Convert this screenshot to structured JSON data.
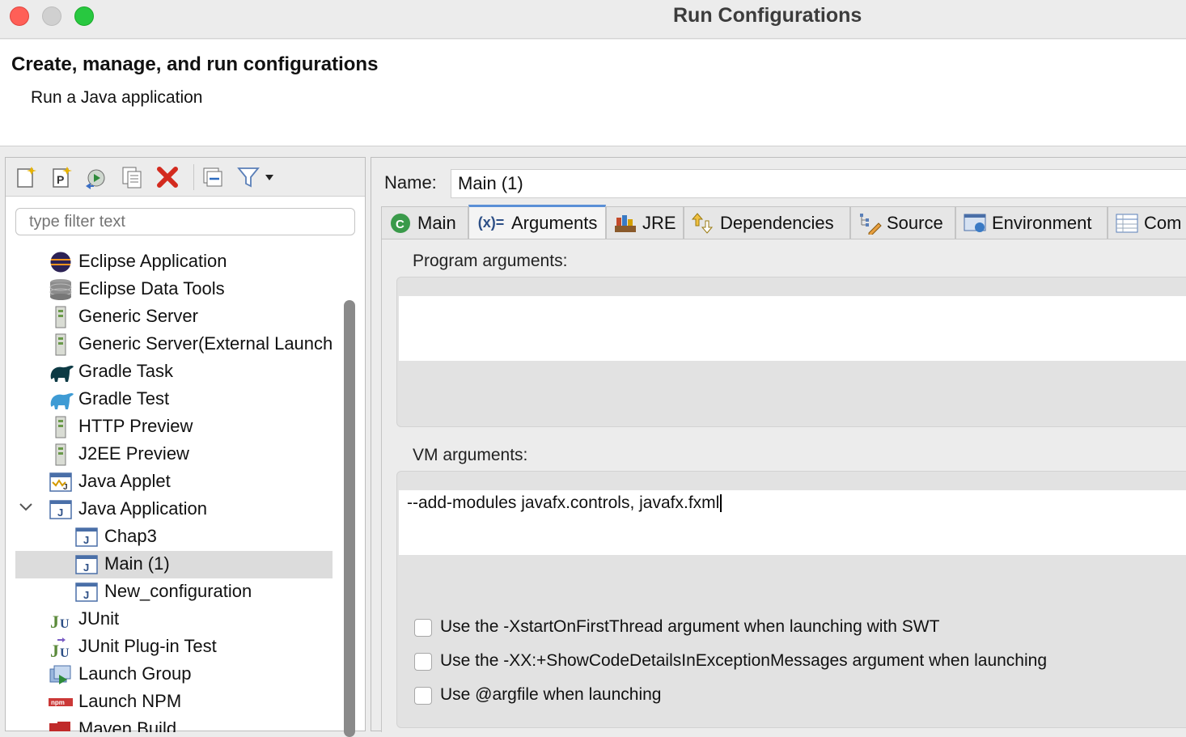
{
  "window": {
    "title": "Run Configurations"
  },
  "header": {
    "title": "Create, manage, and run configurations",
    "subtitle": "Run a Java application"
  },
  "toolbar": {
    "buttons": [
      "new-config-icon",
      "new-prototype-icon",
      "duplicate-icon",
      "copy-icon",
      "delete-icon",
      "collapse-all-icon",
      "filter-icon"
    ]
  },
  "filter": {
    "placeholder": "type filter text"
  },
  "tree": {
    "items": [
      {
        "label": "Eclipse Application",
        "icon": "eclipse-icon",
        "level": 0
      },
      {
        "label": "Eclipse Data Tools",
        "icon": "database-icon",
        "level": 0
      },
      {
        "label": "Generic Server",
        "icon": "server-icon",
        "level": 0
      },
      {
        "label": "Generic Server(External Launch)",
        "icon": "server-icon",
        "level": 0
      },
      {
        "label": "Gradle Task",
        "icon": "gradle-icon",
        "level": 0
      },
      {
        "label": "Gradle Test",
        "icon": "gradle-test-icon",
        "level": 0
      },
      {
        "label": "HTTP Preview",
        "icon": "server-icon",
        "level": 0
      },
      {
        "label": "J2EE Preview",
        "icon": "server-icon",
        "level": 0
      },
      {
        "label": "Java Applet",
        "icon": "java-applet-icon",
        "level": 0
      },
      {
        "label": "Java Application",
        "icon": "java-app-icon",
        "level": 0,
        "expanded": true
      },
      {
        "label": "Chap3",
        "icon": "java-app-icon",
        "level": 1
      },
      {
        "label": "Main (1)",
        "icon": "java-app-icon",
        "level": 1,
        "selected": true
      },
      {
        "label": "New_configuration",
        "icon": "java-app-icon",
        "level": 1
      },
      {
        "label": "JUnit",
        "icon": "junit-icon",
        "level": 0
      },
      {
        "label": "JUnit Plug-in Test",
        "icon": "junit-plugin-icon",
        "level": 0
      },
      {
        "label": "Launch Group",
        "icon": "launch-group-icon",
        "level": 0
      },
      {
        "label": "Launch NPM",
        "icon": "npm-icon",
        "level": 0
      },
      {
        "label": "Maven Build",
        "icon": "maven-icon",
        "level": 0
      }
    ]
  },
  "config": {
    "name_label": "Name:",
    "name_value": "Main (1)",
    "tabs": [
      {
        "label": "Main",
        "icon": "main-tab-icon"
      },
      {
        "label": "Arguments",
        "icon": "arguments-tab-icon",
        "active": true
      },
      {
        "label": "JRE",
        "icon": "jre-tab-icon"
      },
      {
        "label": "Dependencies",
        "icon": "dependencies-tab-icon"
      },
      {
        "label": "Source",
        "icon": "source-tab-icon"
      },
      {
        "label": "Environment",
        "icon": "environment-tab-icon"
      },
      {
        "label": "Com",
        "icon": "common-tab-icon"
      }
    ],
    "arguments_icon_text": "(x)=",
    "program_args_label": "Program arguments:",
    "program_args_value": "",
    "vm_args_label": "VM arguments:",
    "vm_args_value": "--add-modules javafx.controls, javafx.fxml",
    "checkboxes": [
      {
        "label": "Use the -XstartOnFirstThread argument when launching with SWT",
        "checked": false
      },
      {
        "label": "Use the -XX:+ShowCodeDetailsInExceptionMessages argument when launching",
        "checked": false
      },
      {
        "label": "Use @argfile when launching",
        "checked": false
      }
    ]
  }
}
